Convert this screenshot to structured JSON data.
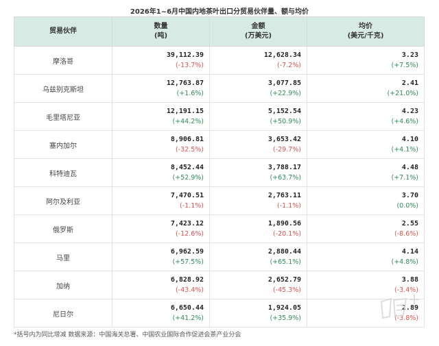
{
  "title": "2026年1~6月中国内地茶叶出口分贸易伙伴量、额与均价",
  "headers": {
    "partner": "贸易伙伴",
    "qty": "数量",
    "qty_unit": "(吨)",
    "amount": "金额",
    "amount_unit": "(万美元)",
    "price": "均价",
    "price_unit": "(美元/千克)"
  },
  "rows": [
    {
      "name": "摩洛哥",
      "qty": "39,112.39",
      "qty_chg": "(-13.7%)",
      "amt": "12,628.34",
      "amt_chg": "(-7.2%)",
      "price": "3.23",
      "price_chg": "(+7.5%)"
    },
    {
      "name": "乌兹别克斯坦",
      "qty": "12,763.87",
      "qty_chg": "(+1.6%)",
      "amt": "3,077.85",
      "amt_chg": "(+22.9%)",
      "price": "2.41",
      "price_chg": "(+21.0%)"
    },
    {
      "name": "毛里塔尼亚",
      "qty": "12,191.15",
      "qty_chg": "(+44.2%)",
      "amt": "5,152.54",
      "amt_chg": "(+50.9%)",
      "price": "4.23",
      "price_chg": "(+4.6%)"
    },
    {
      "name": "塞内加尔",
      "qty": "8,906.81",
      "qty_chg": "(-32.5%)",
      "amt": "3,653.42",
      "amt_chg": "(-29.7%)",
      "price": "4.10",
      "price_chg": "(+4.1%)"
    },
    {
      "name": "科特迪瓦",
      "qty": "8,452.44",
      "qty_chg": "(+52.9%)",
      "amt": "3,788.17",
      "amt_chg": "(+63.7%)",
      "price": "4.48",
      "price_chg": "(+7.1%)"
    },
    {
      "name": "阿尔及利亚",
      "qty": "7,470.51",
      "qty_chg": "(-1.1%)",
      "amt": "2,763.11",
      "amt_chg": "(-1.1%)",
      "price": "3.70",
      "price_chg": "(0.0%)"
    },
    {
      "name": "俄罗斯",
      "qty": "7,423.12",
      "qty_chg": "(-12.6%)",
      "amt": "1,890.56",
      "amt_chg": "(-20.1%)",
      "price": "2.55",
      "price_chg": "(-8.6%)"
    },
    {
      "name": "马里",
      "qty": "6,962.59",
      "qty_chg": "(+57.5%)",
      "amt": "2,880.44",
      "amt_chg": "(+65.1%)",
      "price": "4.14",
      "price_chg": "(+4.8%)"
    },
    {
      "name": "加纳",
      "qty": "6,828.92",
      "qty_chg": "(-43.4%)",
      "amt": "2,652.79",
      "amt_chg": "(-45.3%)",
      "price": "3.88",
      "price_chg": "(-3.4%)"
    },
    {
      "name": "尼日尔",
      "qty": "6,650.44",
      "qty_chg": "(+41.2%)",
      "amt": "1,924.05",
      "amt_chg": "(+35.9%)",
      "price": "2.89",
      "price_chg": "(-3.8%)"
    }
  ],
  "note": "*括号内为同比增减    数据来源：中国海关总署、中国农业国际合作促进会茶产业分会",
  "colors": {
    "header_bg": "#d7ebe4",
    "positive": "#2e8b57",
    "negative": "#d9534f"
  },
  "watermark_icon": "nanfang-plus-logo"
}
